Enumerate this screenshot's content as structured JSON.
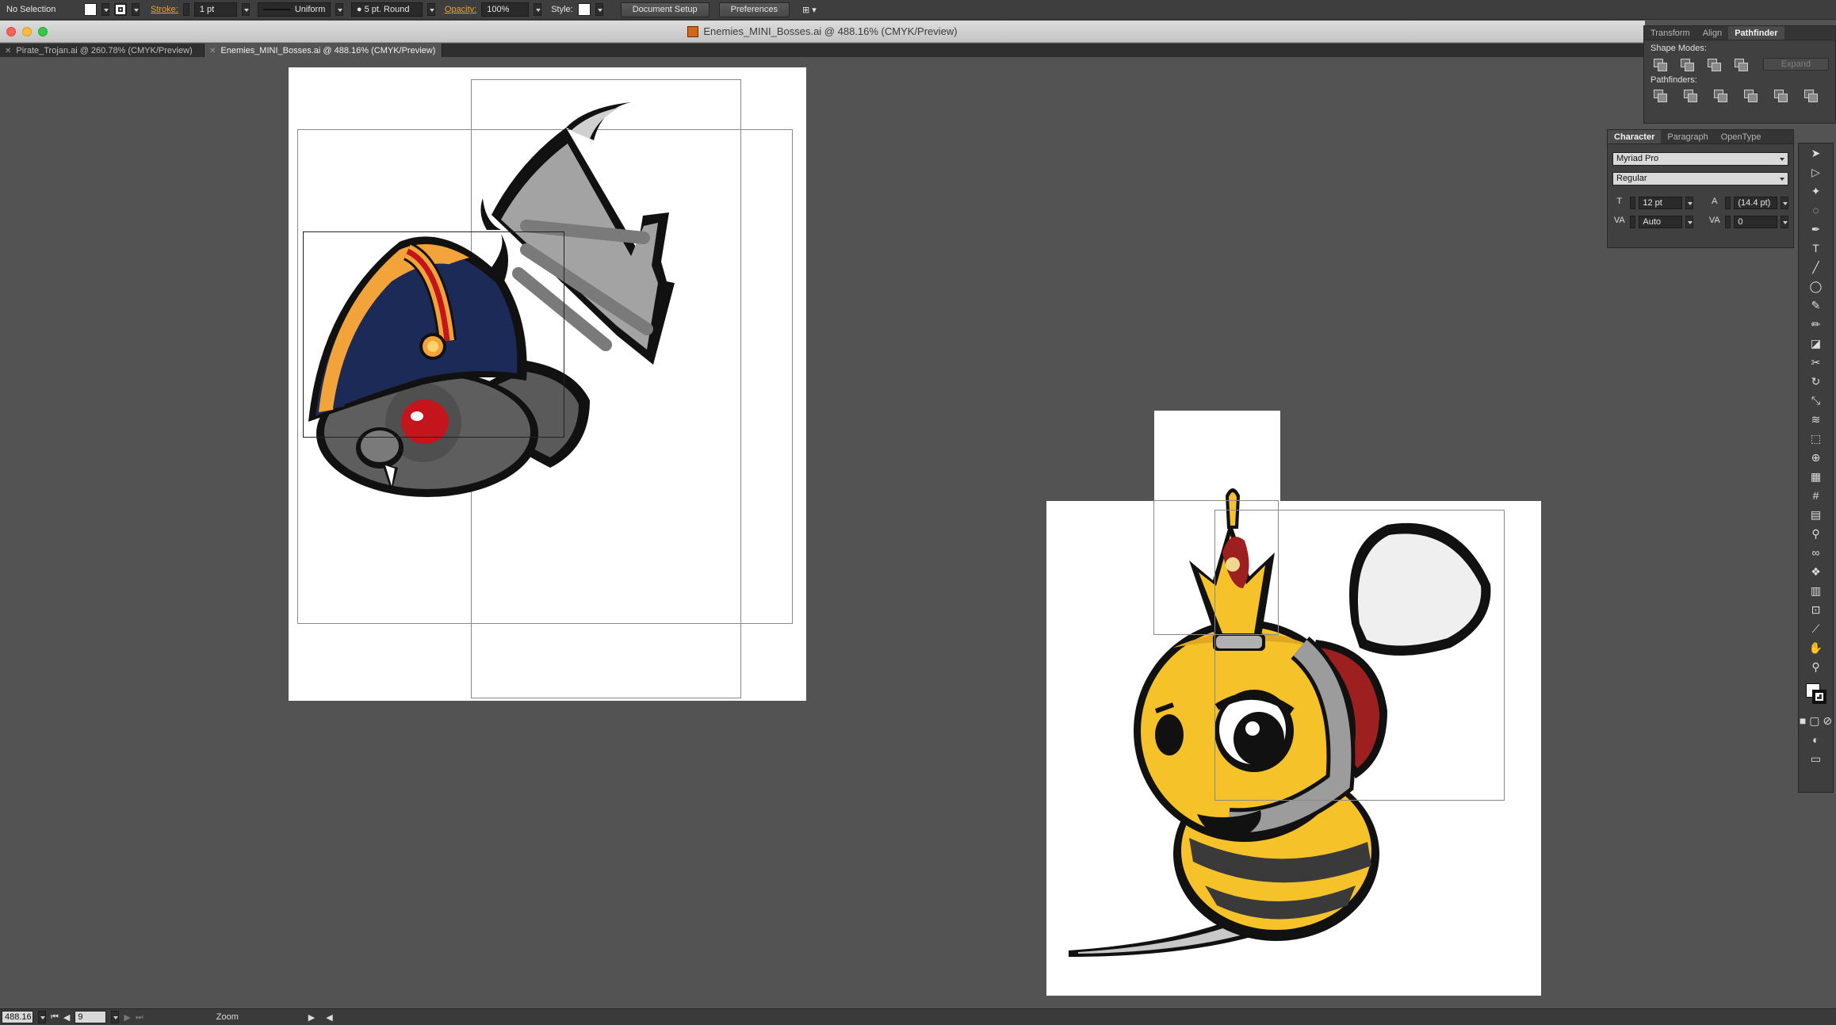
{
  "control_bar": {
    "selection": "No Selection",
    "stroke_label": "Stroke:",
    "stroke_weight": "1 pt",
    "stroke_profile": "Uniform",
    "brush": "5 pt. Round",
    "opacity_label": "Opacity:",
    "opacity_value": "100%",
    "style_label": "Style:",
    "document_setup": "Document Setup",
    "preferences": "Preferences"
  },
  "window": {
    "title": "Enemies_MINI_Bosses.ai @ 488.16% (CMYK/Preview)"
  },
  "tabs": [
    {
      "label": "Pirate_Trojan.ai @ 260.78% (CMYK/Preview)",
      "active": false
    },
    {
      "label": "Enemies_MINI_Bosses.ai @ 488.16% (CMYK/Preview)",
      "active": true
    }
  ],
  "pathfinder_panel": {
    "tabs": [
      "Transform",
      "Align",
      "Pathfinder"
    ],
    "shape_modes_label": "Shape Modes:",
    "pathfinders_label": "Pathfinders:",
    "expand_label": "Expand"
  },
  "character_panel": {
    "tabs": [
      "Character",
      "Paragraph",
      "OpenType"
    ],
    "font_family": "Myriad Pro",
    "font_style": "Regular",
    "font_size": "12 pt",
    "leading": "(14.4 pt)",
    "kerning": "Auto",
    "tracking": "0"
  },
  "status_bar": {
    "zoom_value": "488.16",
    "artboard_number": "9",
    "status_label": "Zoom"
  },
  "colors": {
    "canvas": "#535353",
    "panel": "#404040",
    "bat_hat": "#1c2a57",
    "bee_yellow": "#f6c22a"
  }
}
